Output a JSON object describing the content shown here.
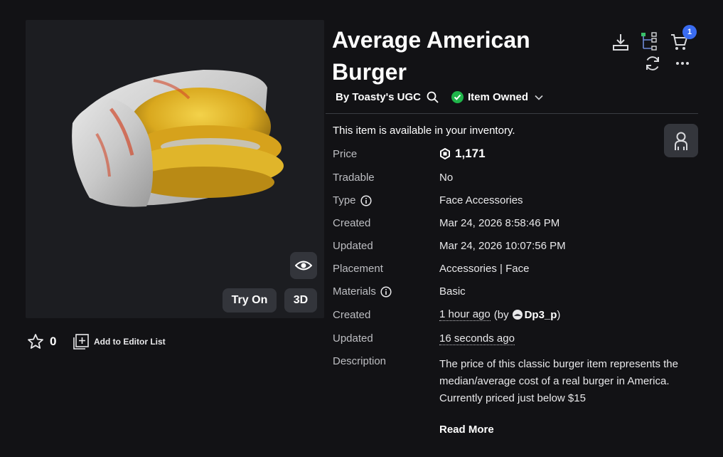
{
  "item": {
    "title": "Average American Burger",
    "creator": "By Toasty's UGC",
    "owned_label": "Item Owned",
    "availability": "This item is available in your inventory."
  },
  "thumbnail": {
    "try_on_label": "Try On",
    "three_d_label": "3D"
  },
  "favorites": {
    "count": "0",
    "editor_list_label": "Add to Editor List"
  },
  "cart": {
    "count": "1"
  },
  "details": {
    "price_label": "Price",
    "price_value": "1,171",
    "tradable_label": "Tradable",
    "tradable_value": "No",
    "type_label": "Type",
    "type_value": "Face Accessories",
    "created_label": "Created",
    "created_value": "Mar 24, 2026 8:58:46 PM",
    "updated_label": "Updated",
    "updated_value": "Mar 24, 2026 10:07:56 PM",
    "placement_label": "Placement",
    "placement_value": "Accessories | Face",
    "materials_label": "Materials",
    "materials_value": "Basic",
    "created2_label": "Created",
    "created2_value": "1 hour ago",
    "created2_by_prefix": "(by",
    "created2_user": "Dp3_p",
    "created2_by_suffix": ")",
    "updated2_label": "Updated",
    "updated2_value": "16 seconds ago",
    "description_label": "Description",
    "description_text": "The price of this classic burger item represents the median/average cost of a real burger in America.",
    "description_line2": "Currently priced just below $15",
    "read_more": "Read More"
  },
  "icons": {
    "download": "download-icon",
    "hierarchy": "hierarchy-icon",
    "cart": "cart-icon",
    "refresh": "refresh-icon",
    "more": "more-icon",
    "search": "search-icon",
    "eye": "eye-icon",
    "star": "star-icon",
    "avatar": "avatar-icon",
    "robux": "robux-icon"
  },
  "colors": {
    "background": "#121215",
    "owned_green": "#20b54a",
    "badge_blue": "#3a6cf0"
  }
}
